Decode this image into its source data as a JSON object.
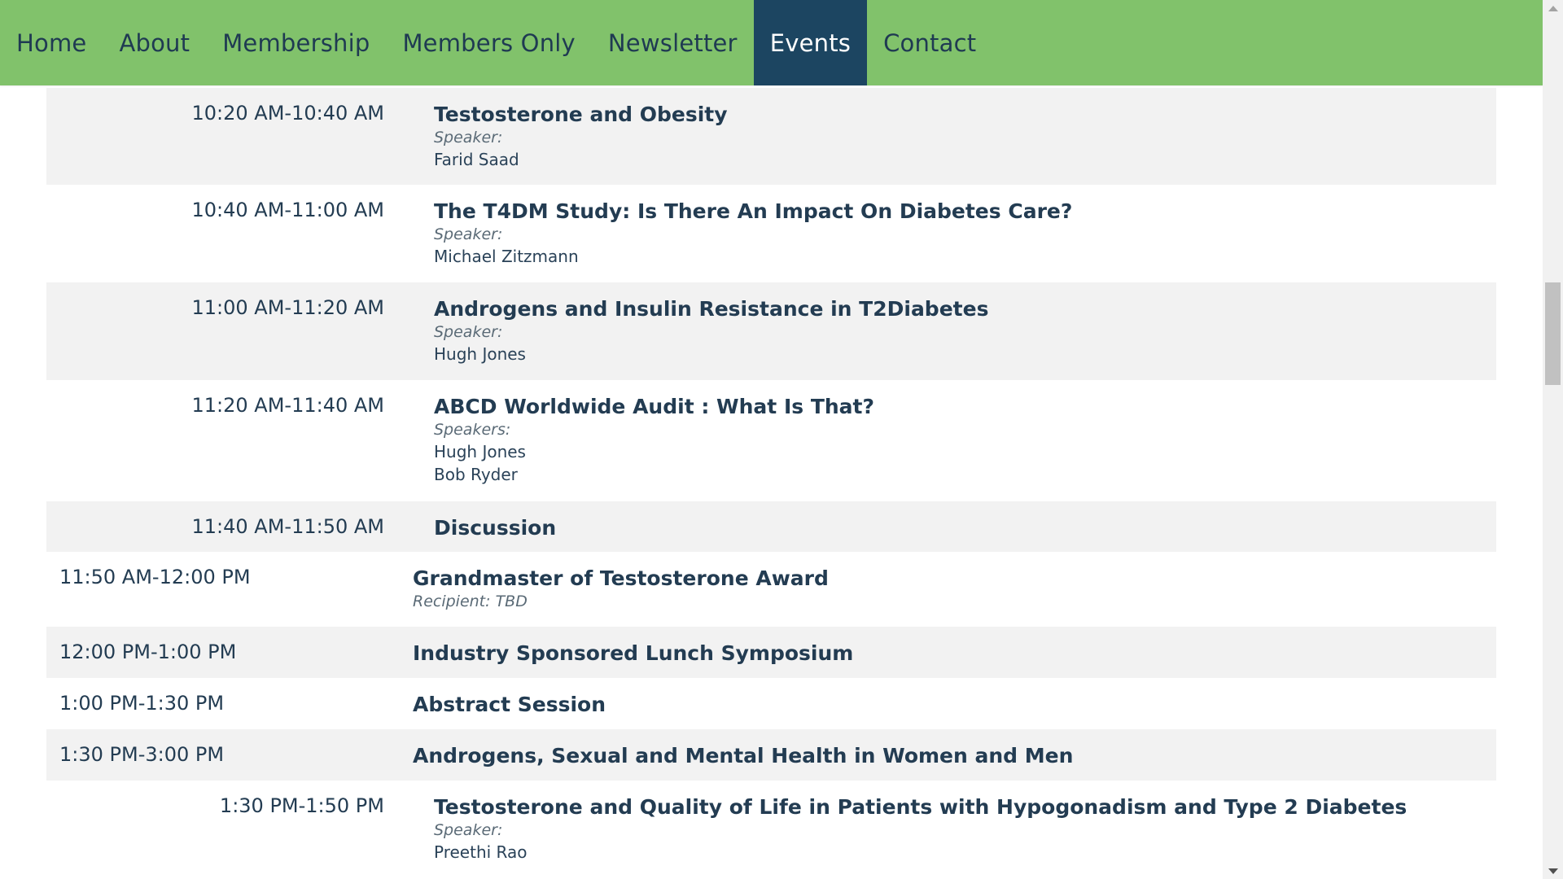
{
  "nav": {
    "items": [
      {
        "label": "Home"
      },
      {
        "label": "About"
      },
      {
        "label": "Membership"
      },
      {
        "label": "Members Only"
      },
      {
        "label": "Newsletter"
      },
      {
        "label": "Events"
      },
      {
        "label": "Contact"
      }
    ],
    "active": "Events"
  },
  "schedule": {
    "rows": [
      {
        "time": "10:20 AM-10:40 AM",
        "title": "Testosterone and Obesity",
        "label": "Speaker:",
        "people": [
          "Farid Saad"
        ]
      },
      {
        "time": "10:40 AM-11:00 AM",
        "title": "The T4DM Study: Is There An Impact On Diabetes Care?",
        "label": "Speaker:",
        "people": [
          "Michael Zitzmann"
        ]
      },
      {
        "time": "11:00 AM-11:20 AM",
        "title": "Androgens and Insulin Resistance in T2Diabetes",
        "label": "Speaker:",
        "people": [
          "Hugh Jones"
        ]
      },
      {
        "time": "11:20 AM-11:40 AM",
        "title": "ABCD Worldwide Audit : What Is That?",
        "label": "Speakers:",
        "people": [
          "Hugh Jones",
          "Bob Ryder"
        ]
      },
      {
        "time": "11:40 AM-11:50 AM",
        "title": "Discussion"
      },
      {
        "time": "11:50 AM-12:00 PM",
        "title": "Grandmaster of Testosterone Award",
        "label": "Recipient: TBD"
      },
      {
        "time": "12:00 PM-1:00 PM",
        "title": "Industry Sponsored Lunch Symposium"
      },
      {
        "time": "1:00 PM-1:30 PM",
        "title": "Abstract Session"
      },
      {
        "time": "1:30 PM-3:00 PM",
        "title": "Androgens, Sexual and Mental Health in Women and Men"
      },
      {
        "time": "1:30 PM-1:50 PM",
        "title": "Testosterone and Quality of Life in Patients with Hypogonadism and Type 2 Diabetes",
        "label": "Speaker:",
        "people": [
          "Preethi Rao"
        ]
      }
    ]
  }
}
